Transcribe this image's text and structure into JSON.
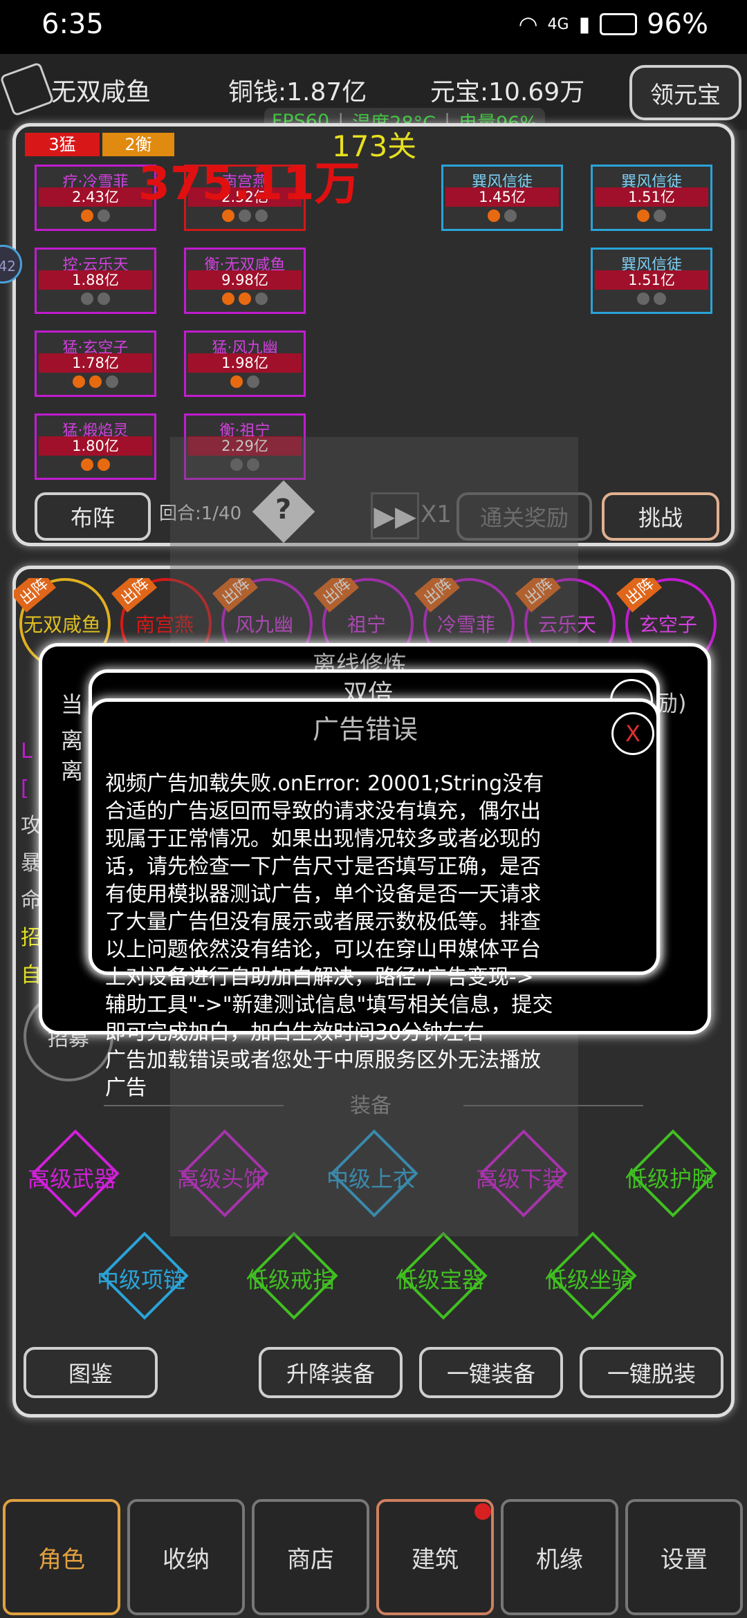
{
  "status_bar": {
    "time": "6:35",
    "battery": "96%",
    "signal": "4G"
  },
  "header": {
    "player_name": "无双咸鱼",
    "copper": "铜钱:1.87亿",
    "yuanbao": "元宝:10.69万",
    "claim_button": "领元宝",
    "fps": "FPS60",
    "temperature": "温度28°C",
    "battery_level": "电量96%",
    "stage": "173关"
  },
  "battle": {
    "tag_fierce": "3猛",
    "tag_balance": "2衡",
    "damage_number": "375.11万",
    "left_side_badge": "42",
    "allies": [
      {
        "name": "疗·冷雪菲",
        "value": "2.43亿",
        "dots": [
          1,
          0
        ]
      },
      {
        "name": "南宫燕",
        "value": "2.52亿",
        "dots": [
          1,
          0,
          0
        ]
      },
      {
        "name": "控·云乐天",
        "value": "1.88亿",
        "dots": [
          0,
          0
        ]
      },
      {
        "name": "衡·无双咸鱼",
        "value": "9.98亿",
        "dots": [
          1,
          1,
          0
        ]
      },
      {
        "name": "猛·玄空子",
        "value": "1.78亿",
        "dots": [
          1,
          1,
          0
        ]
      },
      {
        "name": "猛·风九幽",
        "value": "1.98亿",
        "dots": [
          1,
          0
        ]
      },
      {
        "name": "猛·煅焰灵",
        "value": "1.80亿",
        "dots": [
          1,
          1
        ]
      },
      {
        "name": "衡·祖宁",
        "value": "2.29亿",
        "dots": [
          0,
          0
        ]
      }
    ],
    "enemies": [
      {
        "name": "巽风信徒",
        "value": "1.45亿",
        "dots": [
          1,
          0
        ]
      },
      {
        "name": "巽风信徒",
        "value": "1.51亿",
        "dots": [
          1,
          0
        ]
      },
      {
        "name": "巽风信徒",
        "value": "1.51亿",
        "dots": [
          0,
          0
        ]
      }
    ],
    "formation_button": "布阵",
    "round": "回合:1/40",
    "help_symbol": "?",
    "speed": "X1",
    "clear_reward_button": "通关奖励",
    "challenge_button": "挑战"
  },
  "roster": {
    "deploy_tag": "出阵",
    "heroes": [
      "无双咸鱼",
      "南宫燕",
      "风九幽",
      "祖宁",
      "冷雪菲",
      "云乐天",
      "玄空子"
    ]
  },
  "char_panel": {
    "stats_partial": [
      "当",
      "离",
      "离",
      "L",
      "[",
      "攻",
      "暴",
      "命",
      "招",
      "自"
    ],
    "recruit": "招募",
    "equipment_title": "装备",
    "equipment": [
      {
        "label": "高级武器",
        "color": "#d020d8"
      },
      {
        "label": "高级头饰",
        "color": "#d020d8"
      },
      {
        "label": "中级上衣",
        "color": "#2aa4d8"
      },
      {
        "label": "高级下装",
        "color": "#d020d8"
      },
      {
        "label": "低级护腕",
        "color": "#40c020"
      },
      {
        "label": "中级项链",
        "color": "#2aa4d8"
      },
      {
        "label": "低级戒指",
        "color": "#40c020"
      },
      {
        "label": "低级宝器",
        "color": "#40c020"
      },
      {
        "label": "低级坐骑",
        "color": "#40c020"
      }
    ],
    "atlas_button": "图鉴",
    "upgrade_button": "升降装备",
    "equip_all_button": "一键装备",
    "unequip_all_button": "一键脱装"
  },
  "offline_dialog": {
    "title": "离线修炼",
    "reward_partial": "励)"
  },
  "double_dialog": {
    "title": "双倍"
  },
  "ad_error_dialog": {
    "title": "广告错误",
    "close": "X",
    "lines": [
      "视频广告加载失败.onError: 20001;String没有",
      "合适的广告返回而导致的请求没有填充，偶尔出",
      "现属于正常情况。如果出现情况较多或者必现的",
      "话，请先检查一下广告尺寸是否填写正确，是否",
      "有使用模拟器测试广告，单个设备是否一天请求",
      "了大量广告但没有展示或者展示数极低等。排查",
      "以上问题依然没有结论，可以在穿山甲媒体平台",
      "上对设备进行自助加白解决，路径\"广告变现->",
      "辅助工具\"->\"新建测试信息\"填写相关信息，提交",
      "即可完成加白，加白生效时间30分钟左右",
      "广告加载错误或者您处于中原服务区外无法播放",
      "广告"
    ]
  },
  "bottom_tabs": [
    "角色",
    "收纳",
    "商店",
    "建筑",
    "机缘",
    "设置"
  ]
}
